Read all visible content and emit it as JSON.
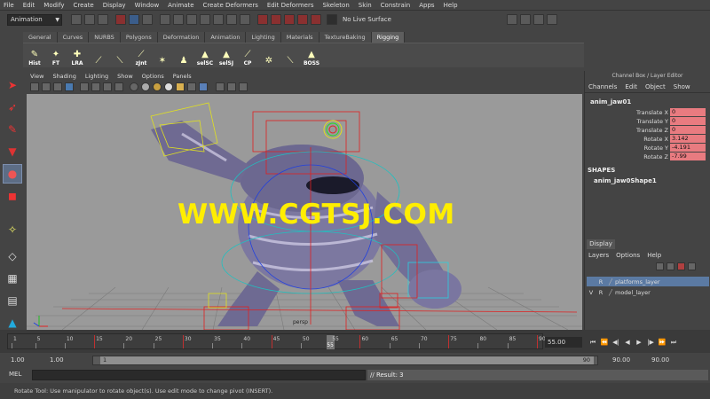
{
  "menubar": [
    "File",
    "Edit",
    "Modify",
    "Create",
    "Display",
    "Window",
    "Animate",
    "Create Deformers",
    "Edit Deformers",
    "Skeleton",
    "Skin",
    "Constrain",
    "Apps",
    "Help"
  ],
  "status_line": {
    "menu_set": "Animation",
    "live_surface": "No Live Surface"
  },
  "shelf_tabs": [
    "General",
    "Curves",
    "NURBS",
    "Polygons",
    "Deformation",
    "Animation",
    "Lighting",
    "Materials",
    "TextureBaking",
    "Rigging"
  ],
  "active_shelf_tab": "Rigging",
  "shelf_buttons": [
    "Hist",
    "FT",
    "LRA",
    "",
    "",
    "zJnt",
    "",
    "",
    "selSC",
    "selSJ",
    "CP",
    "",
    "",
    "BOSS"
  ],
  "viewport": {
    "menu": [
      "View",
      "Shading",
      "Lighting",
      "Show",
      "Options",
      "Panels"
    ],
    "camera_label": "persp",
    "watermark": "WWW.CGTSJ.COM"
  },
  "channel_box": {
    "title": "Channel Box / Layer Editor",
    "menu": [
      "Channels",
      "Edit",
      "Object",
      "Show"
    ],
    "node": "anim_jaw01",
    "attributes": [
      {
        "name": "Translate X",
        "value": "0"
      },
      {
        "name": "Translate Y",
        "value": "0"
      },
      {
        "name": "Translate Z",
        "value": "0"
      },
      {
        "name": "Rotate X",
        "value": "3.142"
      },
      {
        "name": "Rotate Y",
        "value": "-4.191"
      },
      {
        "name": "Rotate Z",
        "value": "-7.99"
      }
    ],
    "shapes_header": "SHAPES",
    "shape_node": "anim_jaw0Shape1"
  },
  "layer_editor": {
    "tab": "Display",
    "menu": [
      "Layers",
      "Options",
      "Help"
    ],
    "layers": [
      {
        "v": "",
        "r": "R",
        "name": "platforms_layer",
        "selected": true
      },
      {
        "v": "V",
        "r": "R",
        "name": "model_layer",
        "selected": false
      }
    ]
  },
  "timeline": {
    "ticks": [
      "1",
      "5",
      "10",
      "15",
      "20",
      "25",
      "30",
      "35",
      "40",
      "45",
      "50",
      "55",
      "60",
      "65",
      "70",
      "75",
      "80",
      "85",
      "90"
    ],
    "current_frame": "55",
    "current_frame_field": "55.00"
  },
  "range": {
    "start": "1.00",
    "playback_start": "1.00",
    "slider_start": "1",
    "slider_end": "90",
    "playback_end": "90.00",
    "end": "90.00"
  },
  "command_line": {
    "label": "MEL",
    "result": "// Result: 3"
  },
  "help_line": "Rotate Tool: Use manipulator to rotate object(s). Use edit mode to change pivot (INSERT)."
}
